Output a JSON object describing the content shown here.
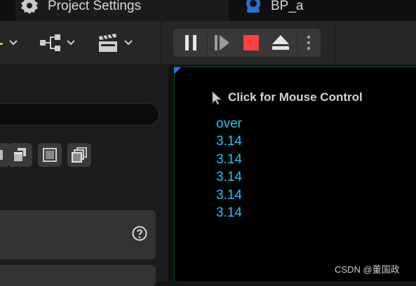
{
  "tabs": [
    {
      "label": "Project Settings",
      "icon": "gear-icon"
    },
    {
      "label": "BP_a",
      "icon": "blueprint-icon"
    }
  ],
  "toolbar": {
    "buttons": [
      "add-content-icon",
      "blueprint-graph-icon",
      "cinematics-clapper-icon"
    ],
    "play_controls": [
      "pause-icon",
      "step-frame-icon",
      "stop-icon",
      "eject-icon",
      "more-options-icon"
    ],
    "colors": {
      "stop": "#ff4040",
      "accent_green": "#9ad14f"
    }
  },
  "viewport": {
    "mouse_hint": "Click for Mouse Control",
    "log_lines": [
      "over",
      "3.14",
      "3.14",
      "3.14",
      "3.14",
      "3.14"
    ],
    "log_color": "#18c8ec"
  },
  "watermark": "CSDN @董国政"
}
